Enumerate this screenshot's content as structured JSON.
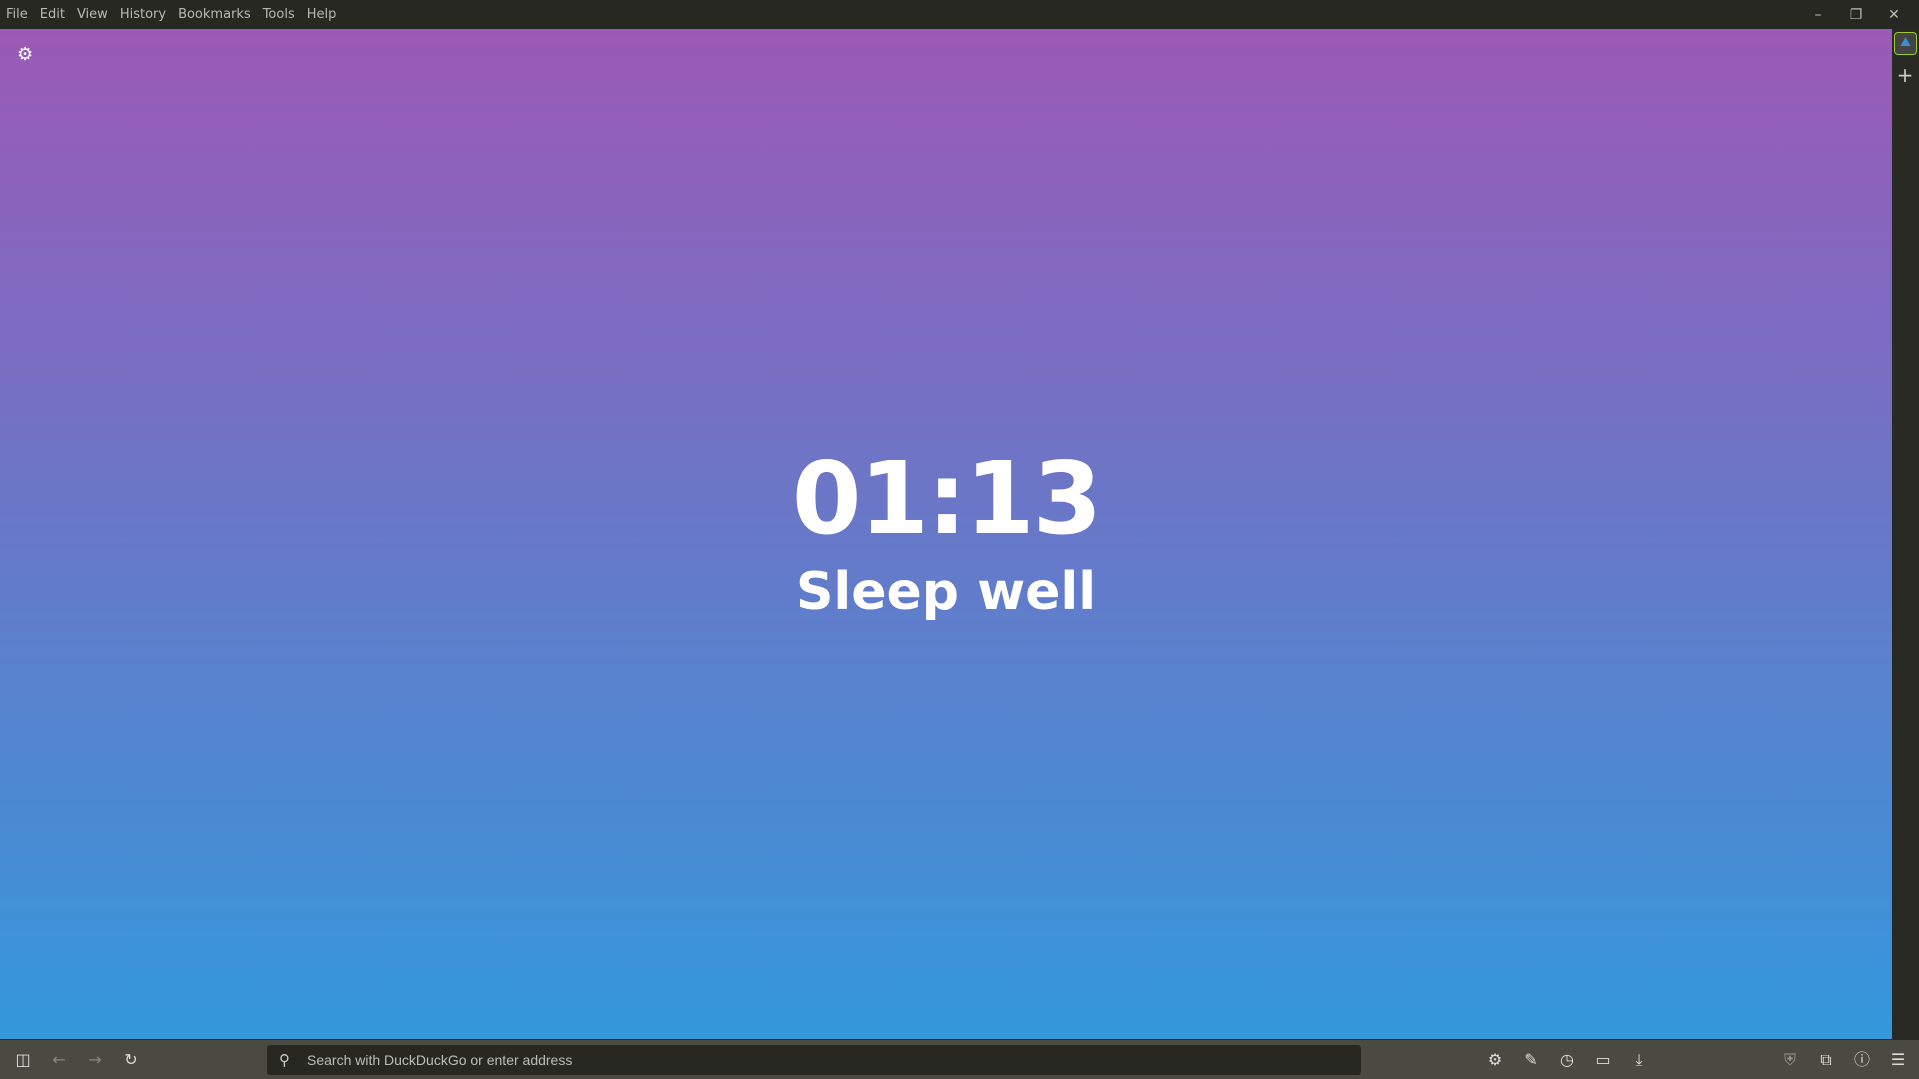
{
  "menu": {
    "items": [
      "File",
      "Edit",
      "View",
      "History",
      "Bookmarks",
      "Tools",
      "Help"
    ]
  },
  "window": {
    "minimize": "–",
    "restore": "❐",
    "close": "✕"
  },
  "content": {
    "clock": "01:13",
    "greeting": "Sleep well",
    "gradient_top": "#9b59b6",
    "gradient_bottom": "#3498db",
    "settings_icon": "gear-icon"
  },
  "sidebar": {
    "panel_icon": "web-panel-icon",
    "add": "+"
  },
  "address": {
    "placeholder": "Search with DuckDuckGo or enter address"
  },
  "statusbar": {
    "icons": [
      "sidebar-icon",
      "back-icon",
      "forward-icon",
      "reload-icon",
      "settings-icon",
      "tools-icon",
      "history-icon",
      "window-icon",
      "download-icon",
      "ublock-icon",
      "extensions-icon",
      "info-icon",
      "menu-icon"
    ]
  }
}
